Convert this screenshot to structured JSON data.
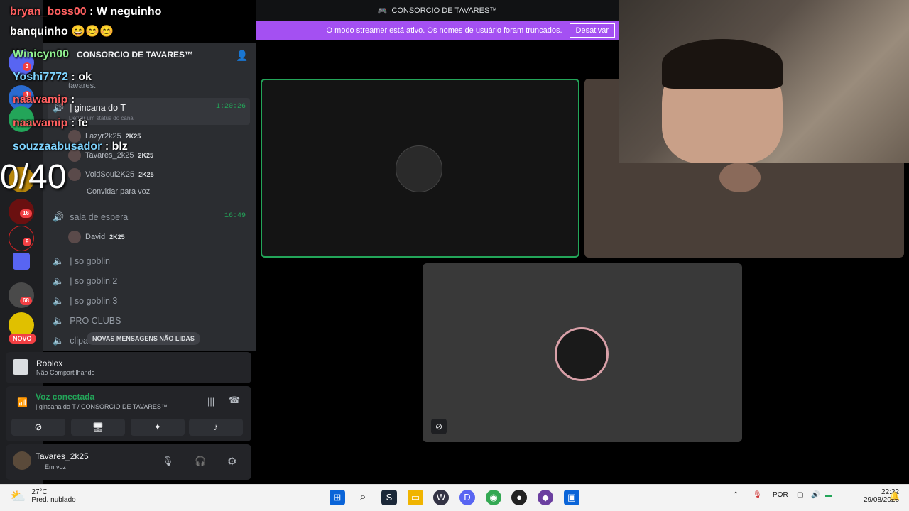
{
  "window": {
    "title": "CONSORCIO DE TAVARES™"
  },
  "banner": {
    "message": "O modo streamer está ativo. Os nomes de usuário foram truncados.",
    "button": "Desativar"
  },
  "server": {
    "name": "CONSORCIO DE TAVARES™"
  },
  "channels": {
    "top_label": "tavares.",
    "active": {
      "name": "| gincana do T",
      "time": "1:20:26",
      "status": "Definir um status do canal"
    },
    "active_users": [
      {
        "name": "Lazyr2k25",
        "badge": "2K25"
      },
      {
        "name": "Tavares_2k25",
        "badge": "2K25"
      },
      {
        "name": "VoidSoul2K25",
        "badge": "2K25"
      }
    ],
    "invite": "Convidar para voz",
    "waiting": {
      "name": "sala de espera",
      "time": "16:49"
    },
    "waiting_user": {
      "name": "David",
      "badge": "2K25"
    },
    "list": [
      "| so goblin",
      "| so goblin 2",
      "| so goblin 3",
      "PRO CLUBS",
      "clipa"
    ],
    "unread": "NOVAS MENSAGENS NÃO LIDAS"
  },
  "activity": {
    "title": "Roblox",
    "subtitle": "Não Compartilhando"
  },
  "voice": {
    "status": "Voz conectada",
    "location": "| gincana do T  / CONSORCIO DE TAVARES™"
  },
  "user": {
    "name": "Tavares_2k25",
    "status": "Em voz"
  },
  "rail": {
    "new_label": "NOVO",
    "badges": [
      "3",
      "1",
      "16",
      "9",
      "68"
    ]
  },
  "overlay": {
    "lines": [
      {
        "user": "bryan_boss00",
        "text": ": W neguinho"
      },
      {
        "user": "",
        "text": "banquinho 😄😊😊"
      },
      {
        "user": "Winicyn00",
        "text": ""
      },
      {
        "user": "Yoshi7772",
        "text": ": ok"
      },
      {
        "user": "naawamip",
        "text": ":"
      },
      {
        "user": "naawamip",
        "text": ": fe"
      },
      {
        "user": "souzzaabusador",
        "text": ": blz"
      }
    ],
    "counter": "0/40"
  },
  "taskbar": {
    "temp": "27°C",
    "weather": "Pred. nublado",
    "lang": "POR",
    "time": "22:22",
    "date": "29/08/2026"
  },
  "colors": {
    "accent": "#a450f2",
    "online": "#23a559",
    "danger": "#f23f43"
  }
}
